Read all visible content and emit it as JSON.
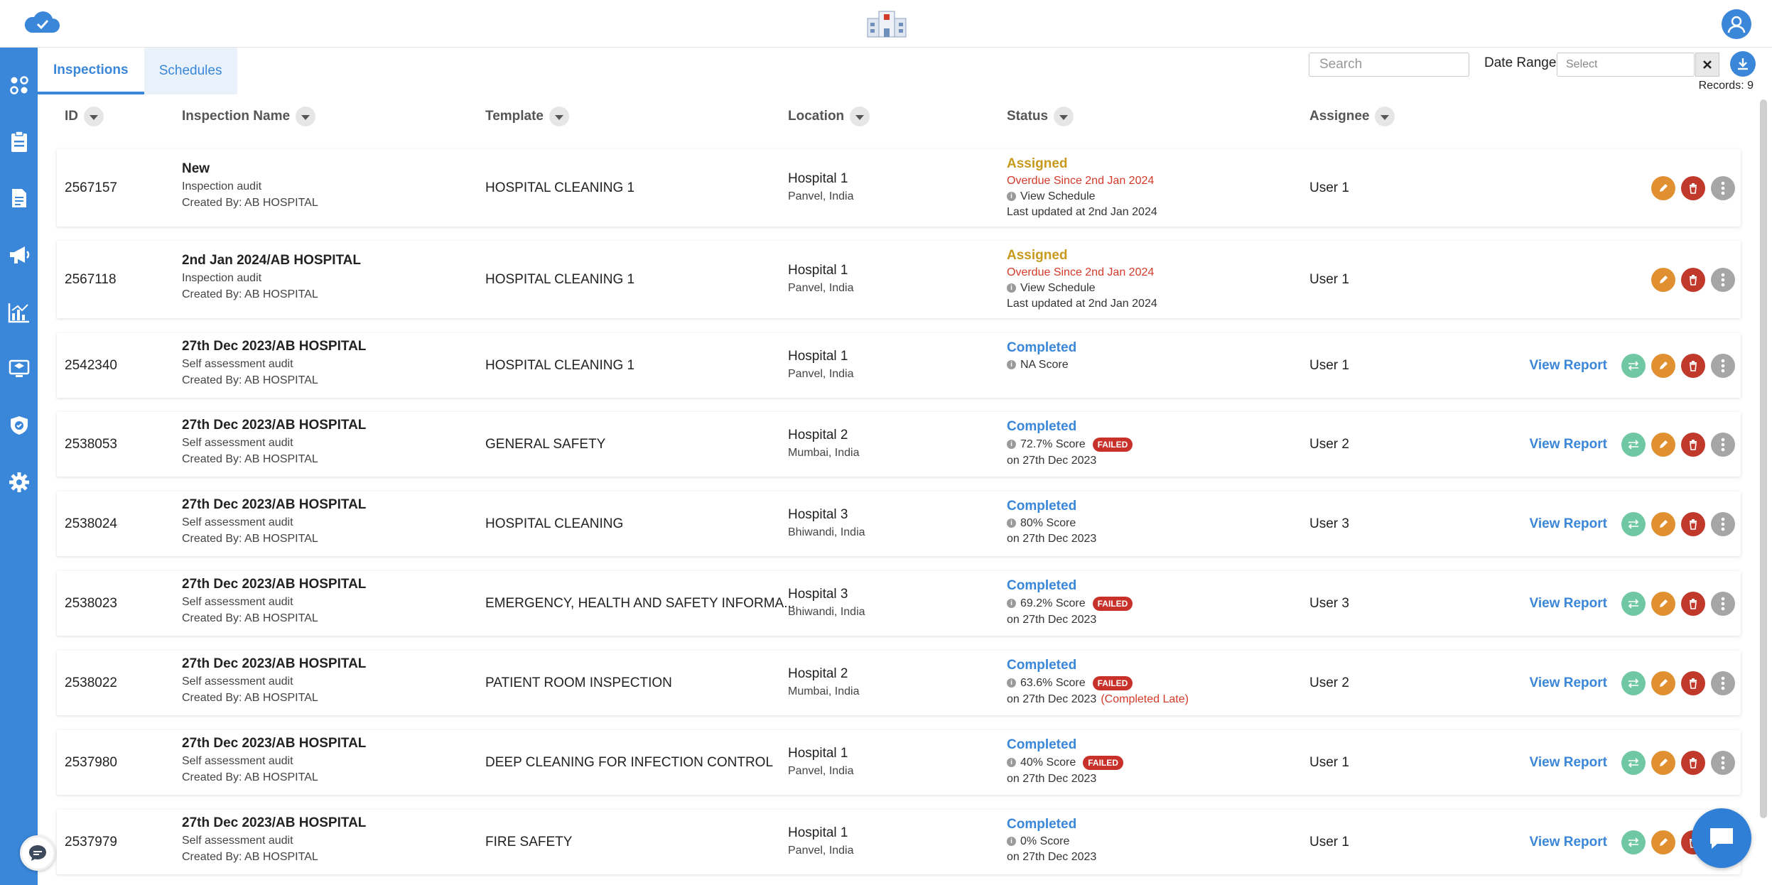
{
  "tabs": [
    {
      "label": "Inspections",
      "active": true
    },
    {
      "label": "Schedules",
      "active": false
    }
  ],
  "search": {
    "placeholder": "Search"
  },
  "date_range": {
    "label": "Date Range",
    "placeholder": "Select"
  },
  "records": "Records: 9",
  "columns": [
    "ID",
    "Inspection Name",
    "Template",
    "Location",
    "Status",
    "Assignee"
  ],
  "view_report_label": "View Report",
  "colors": {
    "brand": "#3a86d8",
    "assigned": "#c79a1e",
    "overdue": "#d33a2a",
    "failed": "#c8312a"
  },
  "icons": {
    "top_logo": "cloud-check-icon",
    "hospital": "hospital-building-icon",
    "user": "user-avatar-icon",
    "sidebar": [
      "dashboard-icon",
      "clipboard-icon",
      "document-icon",
      "megaphone-icon",
      "analytics-icon",
      "training-icon",
      "shield-check-icon",
      "settings-gear-icon"
    ],
    "download": "download-icon",
    "chat": "chat-icon"
  },
  "rows": [
    {
      "id": "2567157",
      "name": "New",
      "type": "Inspection audit",
      "created_by": "Created By: AB HOSPITAL",
      "template": "HOSPITAL CLEANING 1",
      "location": "Hospital 1",
      "city": "Panvel, India",
      "status": "Assigned",
      "overdue": "Overdue Since 2nd Jan 2024",
      "info": "View Schedule",
      "footer": "Last updated at 2nd Jan 2024",
      "late": "",
      "failed": "",
      "assignee": "User 1",
      "completed": false
    },
    {
      "id": "2567118",
      "name": "2nd Jan 2024/AB HOSPITAL",
      "type": "Inspection audit",
      "created_by": "Created By: AB HOSPITAL",
      "template": "HOSPITAL CLEANING 1",
      "location": "Hospital 1",
      "city": "Panvel, India",
      "status": "Assigned",
      "overdue": "Overdue Since 2nd Jan 2024",
      "info": "View Schedule",
      "footer": "Last updated at 2nd Jan 2024",
      "late": "",
      "failed": "",
      "assignee": "User 1",
      "completed": false
    },
    {
      "id": "2542340",
      "name": "27th Dec 2023/AB HOSPITAL",
      "type": "Self assessment audit",
      "created_by": "Created By: AB HOSPITAL",
      "template": "HOSPITAL CLEANING 1",
      "location": "Hospital 1",
      "city": "Panvel, India",
      "status": "Completed",
      "overdue": "",
      "info": "NA  Score",
      "footer": "",
      "late": "",
      "failed": "",
      "assignee": "User 1",
      "completed": true
    },
    {
      "id": "2538053",
      "name": "27th Dec 2023/AB HOSPITAL",
      "type": "Self assessment audit",
      "created_by": "Created By: AB HOSPITAL",
      "template": "GENERAL SAFETY",
      "location": "Hospital 2",
      "city": "Mumbai, India",
      "status": "Completed",
      "overdue": "",
      "info": "72.7% Score",
      "footer": "on 27th Dec 2023",
      "late": "",
      "failed": "FAILED",
      "assignee": "User 2",
      "completed": true
    },
    {
      "id": "2538024",
      "name": "27th Dec 2023/AB HOSPITAL",
      "type": "Self assessment audit",
      "created_by": "Created By: AB HOSPITAL",
      "template": "HOSPITAL CLEANING",
      "location": "Hospital 3",
      "city": "Bhiwandi, India",
      "status": "Completed",
      "overdue": "",
      "info": "80%  Score",
      "footer": "on 27th Dec 2023",
      "late": "",
      "failed": "",
      "assignee": "User 3",
      "completed": true
    },
    {
      "id": "2538023",
      "name": "27th Dec 2023/AB HOSPITAL",
      "type": "Self assessment audit",
      "created_by": "Created By: AB HOSPITAL",
      "template": "EMERGENCY, HEALTH AND SAFETY INFORMA...",
      "location": "Hospital 3",
      "city": "Bhiwandi, India",
      "status": "Completed",
      "overdue": "",
      "info": "69.2% Score",
      "footer": "on 27th Dec 2023",
      "late": "",
      "failed": "FAILED",
      "assignee": "User 3",
      "completed": true
    },
    {
      "id": "2538022",
      "name": "27th Dec 2023/AB HOSPITAL",
      "type": "Self assessment audit",
      "created_by": "Created By: AB HOSPITAL",
      "template": "PATIENT ROOM INSPECTION",
      "location": "Hospital 2",
      "city": "Mumbai, India",
      "status": "Completed",
      "overdue": "",
      "info": "63.6% Score",
      "footer": "on 27th Dec 2023",
      "late": "(Completed Late)",
      "failed": "FAILED",
      "assignee": "User 2",
      "completed": true
    },
    {
      "id": "2537980",
      "name": "27th Dec 2023/AB HOSPITAL",
      "type": "Self assessment audit",
      "created_by": "Created By: AB HOSPITAL",
      "template": "DEEP CLEANING FOR INFECTION CONTROL",
      "location": "Hospital 1",
      "city": "Panvel, India",
      "status": "Completed",
      "overdue": "",
      "info": "40% Score",
      "footer": "on 27th Dec 2023",
      "late": "",
      "failed": "FAILED",
      "assignee": "User 1",
      "completed": true
    },
    {
      "id": "2537979",
      "name": "27th Dec 2023/AB HOSPITAL",
      "type": "Self assessment audit",
      "created_by": "Created By: AB HOSPITAL",
      "template": "FIRE SAFETY",
      "location": "Hospital 1",
      "city": "Panvel, India",
      "status": "Completed",
      "overdue": "",
      "info": "0%  Score",
      "footer": "on 27th Dec 2023",
      "late": "",
      "failed": "",
      "assignee": "User 1",
      "completed": true
    }
  ]
}
